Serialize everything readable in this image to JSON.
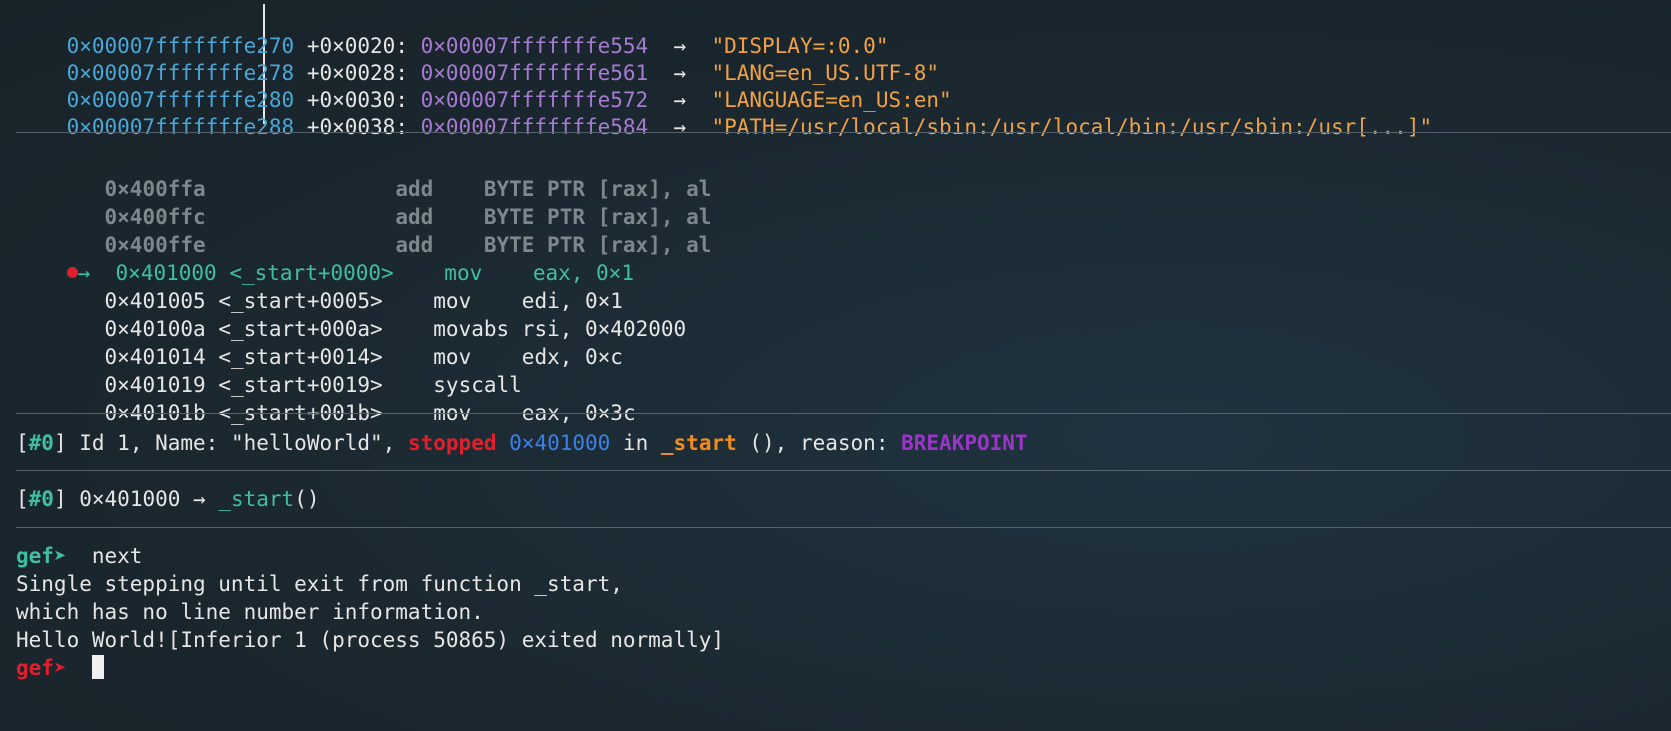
{
  "stack": [
    {
      "addr": "0×00007fffffffe270",
      "off": "+0×0020:",
      "ptr": "0×00007fffffffe554",
      "arrow": "→",
      "val": "\"DISPLAY=:0.0\""
    },
    {
      "addr": "0×00007fffffffe278",
      "off": "+0×0028:",
      "ptr": "0×00007fffffffe561",
      "arrow": "→",
      "val": "\"LANG=en_US.UTF-8\""
    },
    {
      "addr": "0×00007fffffffe280",
      "off": "+0×0030:",
      "ptr": "0×00007fffffffe572",
      "arrow": "→",
      "val": "\"LANGUAGE=en_US:en\""
    },
    {
      "addr": "0×00007fffffffe288",
      "off": "+0×0038:",
      "ptr": "0×00007fffffffe584",
      "arrow": "→",
      "val": "\"PATH=/usr/local/sbin:/usr/local/bin:/usr/sbin:/usr[...]\""
    }
  ],
  "code": [
    {
      "addr": "0×400ffa",
      "sym": "",
      "mnem": "add",
      "ops": "BYTE PTR [rax], al",
      "state": "past"
    },
    {
      "addr": "0×400ffc",
      "sym": "",
      "mnem": "add",
      "ops": "BYTE PTR [rax], al",
      "state": "past"
    },
    {
      "addr": "0×400ffe",
      "sym": "",
      "mnem": "add",
      "ops": "BYTE PTR [rax], al",
      "state": "past"
    },
    {
      "addr": "0×401000",
      "sym": "<_start+0000>",
      "mnem": "mov",
      "ops": "eax, 0×1",
      "state": "current"
    },
    {
      "addr": "0×401005",
      "sym": "<_start+0005>",
      "mnem": "mov",
      "ops": "edi, 0×1",
      "state": "next"
    },
    {
      "addr": "0×40100a",
      "sym": "<_start+000a>",
      "mnem": "movabs",
      "ops": "rsi, 0×402000",
      "state": "next"
    },
    {
      "addr": "0×401014",
      "sym": "<_start+0014>",
      "mnem": "mov",
      "ops": "edx, 0×c",
      "state": "next"
    },
    {
      "addr": "0×401019",
      "sym": "<_start+0019>",
      "mnem": "syscall",
      "ops": "",
      "state": "next"
    },
    {
      "addr": "0×40101b",
      "sym": "<_start+001b>",
      "mnem": "mov",
      "ops": "eax, 0×3c",
      "state": "next"
    }
  ],
  "current_marker": "→",
  "threads": {
    "open": "[",
    "id": "#0",
    "close": "]",
    "text1": " Id 1, Name: \"helloWorld\", ",
    "state": "stopped",
    "addr": "0×401000",
    "in": " in ",
    "func": "_start",
    "text2": " (), reason: ",
    "reason": "BREAKPOINT"
  },
  "trace": {
    "open": "[",
    "id": "#0",
    "close": "]",
    "text": " 0×401000 → ",
    "func": "_start",
    "parens": "()"
  },
  "console": {
    "prompt": "gef➤",
    "command": "next",
    "output": [
      "Single stepping until exit from function _start,",
      "which has no line number information.",
      "Hello World![Inferior 1 (process 50865) exited normally]"
    ]
  },
  "colors": {
    "background": "#1b2830",
    "address": "#4aa8d8",
    "pointer": "#a67bd1",
    "string": "#f1a145",
    "current": "#3fbfa0",
    "stopped": "#e01f2d",
    "breakpoint": "#9a35c8"
  }
}
